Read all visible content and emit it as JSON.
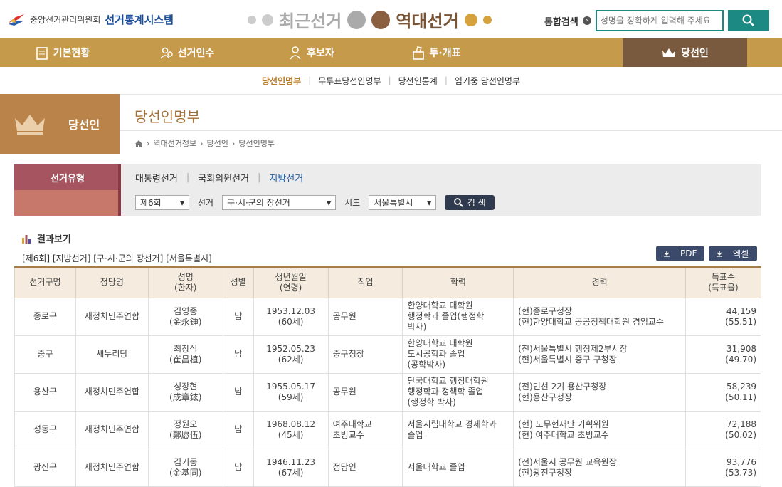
{
  "header": {
    "org": "중앙선거관리위원회",
    "system": "선거통계시스템",
    "recent": "최근선거",
    "past": "역대선거",
    "search_label": "통합검색",
    "search_placeholder": "성명을 정확하게 입력해 주세요"
  },
  "nav": [
    {
      "label": "기본현황",
      "icon": "clipboard-icon"
    },
    {
      "label": "선거인수",
      "icon": "people-icon"
    },
    {
      "label": "후보자",
      "icon": "person-icon"
    },
    {
      "label": "투·개표",
      "icon": "ballot-icon"
    },
    {
      "label": "당선인",
      "icon": "crown-icon"
    }
  ],
  "subnav": [
    "당선인명부",
    "무투표당선인명부",
    "당선인통계",
    "임기중 당선인명부"
  ],
  "side": {
    "title": "당선인"
  },
  "page": {
    "title": "당선인명부",
    "breadcrumb": [
      "역대선거정보",
      "당선인",
      "당선인명부"
    ]
  },
  "filter": {
    "type_label": "선거유형",
    "tabs": [
      "대통령선거",
      "국회의원선거",
      "지방선거"
    ],
    "round": "제6회",
    "elec_label": "선거",
    "elec": "구·시·군의 장선거",
    "sido_label": "시도",
    "sido": "서울특별시",
    "search_btn": "검 색"
  },
  "result": {
    "title": "결과보기",
    "condition": "[제6회] [지방선거] [구·시·군의 장선거] [서울특별시]",
    "pdf": "PDF",
    "excel": "엑셀"
  },
  "table": {
    "headers": [
      [
        "선거구명"
      ],
      [
        "정당명"
      ],
      [
        "성명",
        "(한자)"
      ],
      [
        "성별"
      ],
      [
        "생년월일",
        "(연령)"
      ],
      [
        "직업"
      ],
      [
        "학력"
      ],
      [
        "경력"
      ],
      [
        "득표수",
        "(득표율)"
      ]
    ],
    "rows": [
      {
        "district": "종로구",
        "party": "새정치민주연합",
        "name": [
          "김영종",
          "(金永鍾)"
        ],
        "sex": "남",
        "birth": [
          "1953.12.03",
          "(60세)"
        ],
        "job": [
          "공무원"
        ],
        "edu": [
          "한양대학교 대학원",
          "행정학과 졸업(행정학",
          "박사)"
        ],
        "career": [
          "(현)종로구청장",
          "(현)한양대학교 공공정책대학원 겸임교수"
        ],
        "votes": [
          "44,159",
          "(55.51)"
        ]
      },
      {
        "district": "중구",
        "party": "새누리당",
        "name": [
          "최창식",
          "(崔昌植)"
        ],
        "sex": "남",
        "birth": [
          "1952.05.23",
          "(62세)"
        ],
        "job": [
          "중구청장"
        ],
        "edu": [
          "한양대학교 대학원",
          "도시공학과 졸업",
          "(공학박사)"
        ],
        "career": [
          "(전)서울특별시 행정제2부시장",
          "(현)서울특별시 중구 구청장"
        ],
        "votes": [
          "31,908",
          "(49.70)"
        ]
      },
      {
        "district": "용산구",
        "party": "새정치민주연합",
        "name": [
          "성장현",
          "(成章鉉)"
        ],
        "sex": "남",
        "birth": [
          "1955.05.17",
          "(59세)"
        ],
        "job": [
          "공무원"
        ],
        "edu": [
          "단국대학교 행정대학원",
          "행정학과 정책학 졸업",
          "(행정학 박사)"
        ],
        "career": [
          "(전)민선 2기 용산구청장",
          "(현)용산구청장"
        ],
        "votes": [
          "58,239",
          "(50.11)"
        ]
      },
      {
        "district": "성동구",
        "party": "새정치민주연합",
        "name": [
          "정원오",
          "(鄭愿伍)"
        ],
        "sex": "남",
        "birth": [
          "1968.08.12",
          "(45세)"
        ],
        "job": [
          "여주대학교",
          "초빙교수"
        ],
        "edu": [
          "서울시립대학교 경제학과",
          "졸업"
        ],
        "career": [
          "(현) 노무현재단 기획위원",
          "(현) 여주대학교 초빙교수"
        ],
        "votes": [
          "72,188",
          "(50.02)"
        ]
      },
      {
        "district": "광진구",
        "party": "새정치민주연합",
        "name": [
          "김기동",
          "(金基同)"
        ],
        "sex": "남",
        "birth": [
          "1946.11.23",
          "(67세)"
        ],
        "job": [
          "정당인"
        ],
        "edu": [
          "서울대학교 졸업"
        ],
        "career": [
          "(전)서울시 공무원 교육원장",
          "(현)광진구청장"
        ],
        "votes": [
          "93,776",
          "(53.73)"
        ]
      }
    ]
  },
  "colors": {
    "gold": "#c69a4b",
    "brown": "#7a5a3e",
    "teal": "#1c8a83",
    "maroon": "#a65560"
  }
}
